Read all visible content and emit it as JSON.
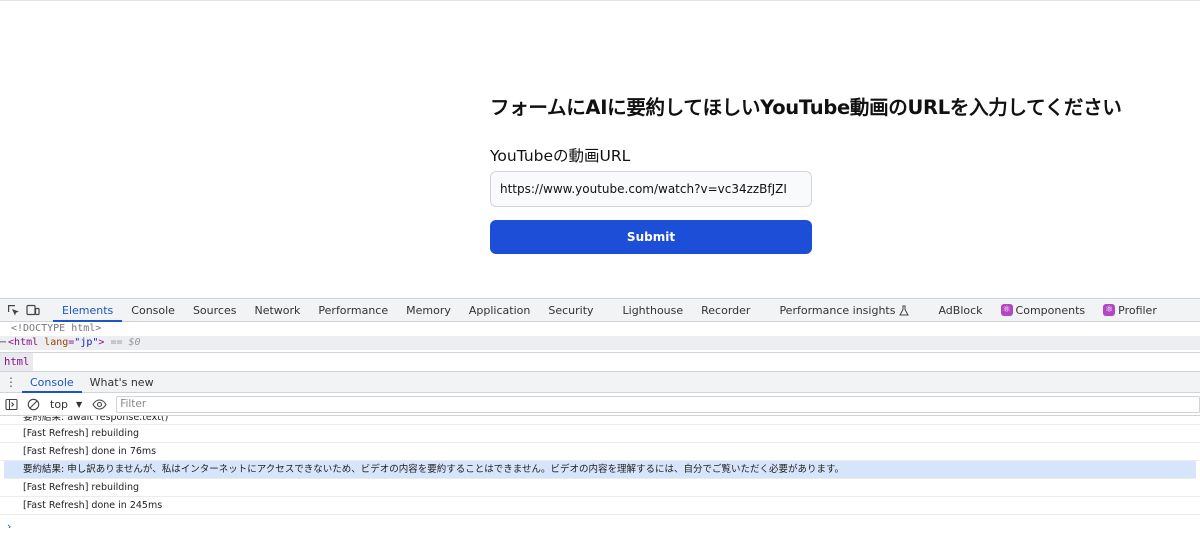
{
  "form": {
    "title": "フォームにAIに要約してほしいYouTube動画のURLを入力してください",
    "label": "YouTubeの動画URL",
    "url_value": "https://www.youtube.com/watch?v=vc34zzBfJZI",
    "submit_label": "Submit",
    "accent_color": "#1d4ed8"
  },
  "devtools": {
    "tabs": [
      {
        "label": "Elements",
        "active": true
      },
      {
        "label": "Console"
      },
      {
        "label": "Sources"
      },
      {
        "label": "Network"
      },
      {
        "label": "Performance"
      },
      {
        "label": "Memory"
      },
      {
        "label": "Application"
      },
      {
        "label": "Security"
      },
      {
        "label": "Lighthouse"
      },
      {
        "label": "Recorder"
      },
      {
        "label": "Performance insights"
      },
      {
        "label": "AdBlock"
      },
      {
        "label": "Components",
        "icon": "react-icon"
      },
      {
        "label": "Profiler",
        "icon": "react-icon"
      }
    ],
    "elements": {
      "doctype": "<!DOCTYPE html>",
      "html_tag_open": "<html",
      "attr_name": "lang",
      "attr_value": "\"jp\"",
      "html_tag_close": ">",
      "eq_marker": "== $0"
    },
    "breadcrumb": "html",
    "drawer_tabs": [
      {
        "label": "Console",
        "active": true
      },
      {
        "label": "What's new"
      }
    ],
    "console_toolbar": {
      "context": "top",
      "filter_placeholder": "Filter"
    },
    "messages": [
      "要約結果: await response.text()",
      "[Fast Refresh] rebuilding",
      "[Fast Refresh] done in 76ms",
      "要約結果: 申し訳ありませんが、私はインターネットにアクセスできないため、ビデオの内容を要約することはできません。ビデオの内容を理解するには、自分でご覧いただく必要があります。",
      "[Fast Refresh] rebuilding",
      "[Fast Refresh] done in 245ms"
    ],
    "prompt_symbol": "›"
  }
}
